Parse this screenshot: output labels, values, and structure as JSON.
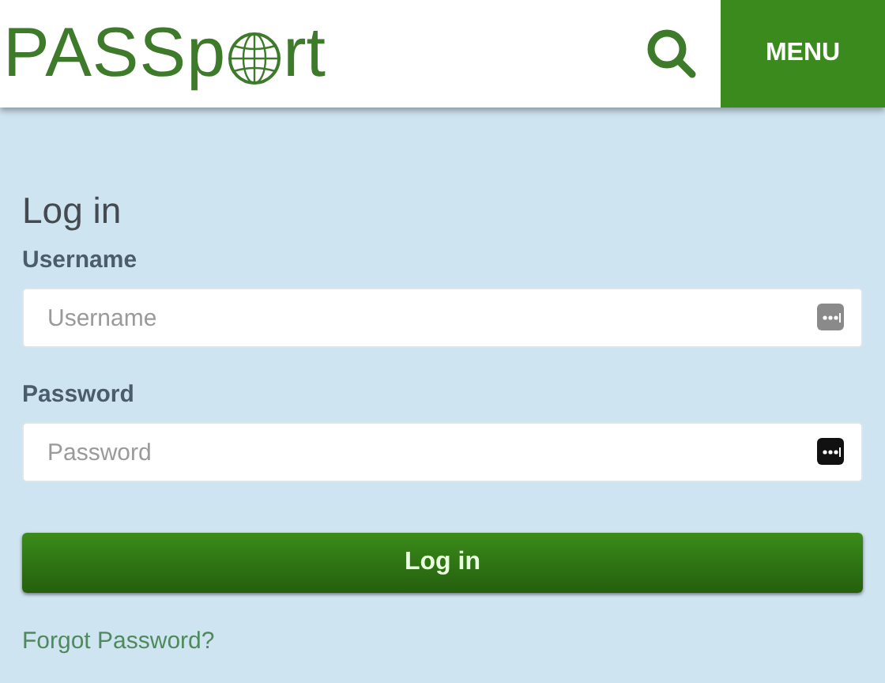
{
  "header": {
    "logo": {
      "before_globe": "PASSp",
      "after_globe": "rt"
    },
    "menu_button": "MENU"
  },
  "form": {
    "title": "Log in",
    "fields": [
      {
        "label": "Username",
        "placeholder": "Username",
        "icon_dark": false
      },
      {
        "label": "Password",
        "placeholder": "Password",
        "icon_dark": true
      }
    ],
    "submit": "Log in",
    "forgot_link": "Forgot Password?"
  }
}
